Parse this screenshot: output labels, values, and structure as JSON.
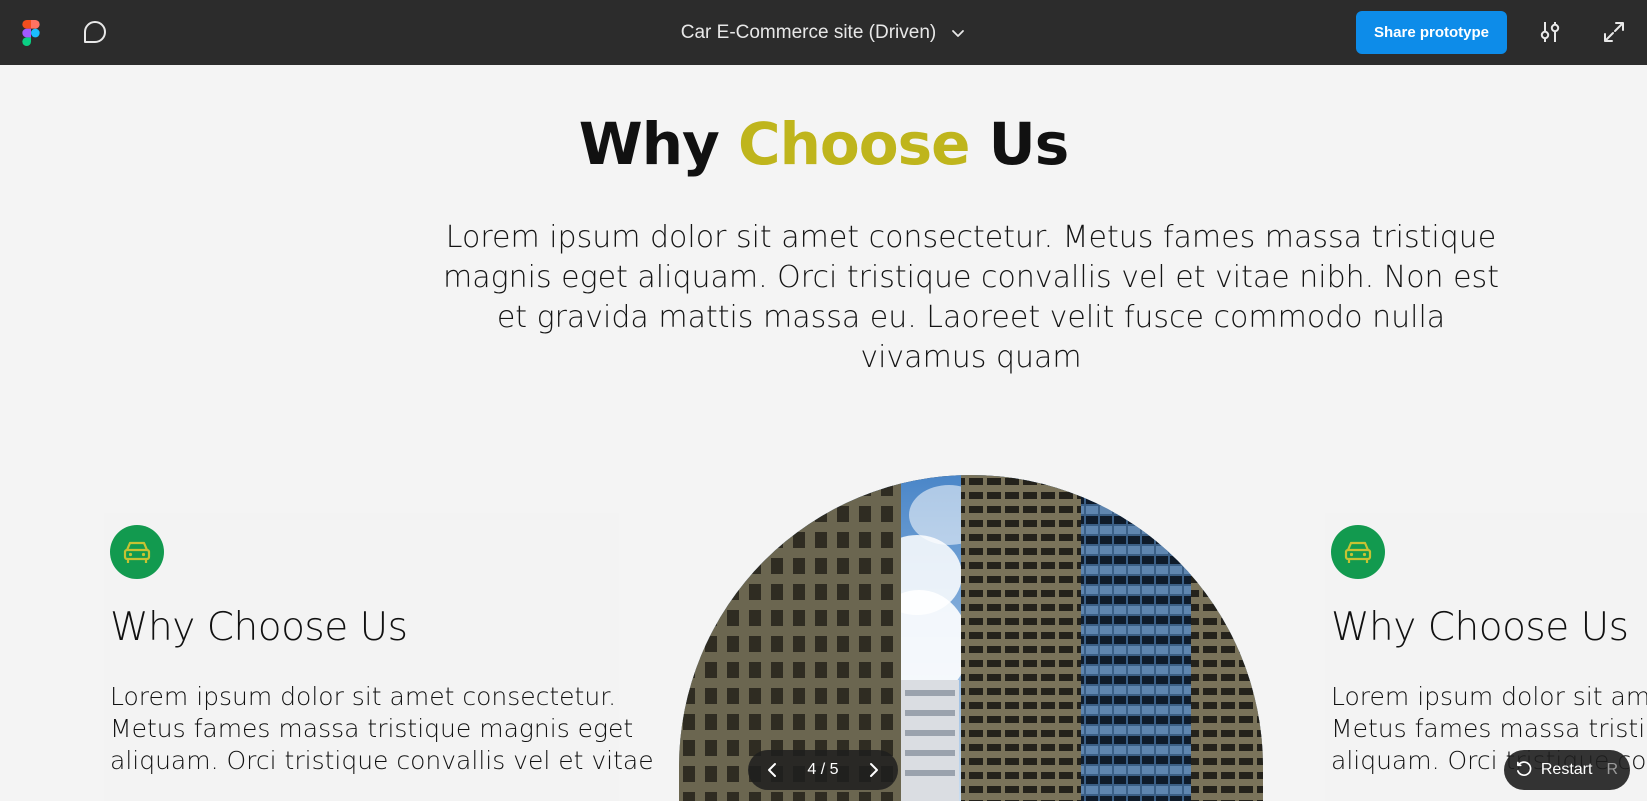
{
  "toolbar": {
    "file_title": "Car E-Commerce site (Driven)",
    "share_label": "Share prototype"
  },
  "hero": {
    "title_part1": "Why",
    "title_accent": "Choose",
    "title_part2": "Us",
    "accent_color": "#bfb51c",
    "intro": "Lorem ipsum dolor sit amet consectetur. Metus fames massa tristique magnis eget aliquam. Orci tristique convallis vel et vitae nibh. Non est et gravida mattis massa eu. Laoreet velit fusce commodo nulla vivamus quam"
  },
  "cards": [
    {
      "icon": "car-icon",
      "title": "Why Choose Us",
      "lines": [
        "Lorem ipsum dolor sit amet consectetur.",
        "Metus fames massa tristique magnis eget",
        "aliquam. Orci tristique convallis vel et vitae"
      ]
    },
    {
      "icon": "car-icon",
      "title": "Why Choose Us",
      "lines": [
        "Lorem ipsum dolor sit amet",
        "Metus fames massa tristique",
        "aliquam. Orci tristique conv"
      ]
    }
  ],
  "pager": {
    "label": "4 / 5"
  },
  "restart": {
    "label": "Restart",
    "shortcut": "R"
  },
  "colors": {
    "toolbar": "#2c2c2c",
    "share_button": "#0d8ce9",
    "icon_circle": "#129a4f"
  }
}
